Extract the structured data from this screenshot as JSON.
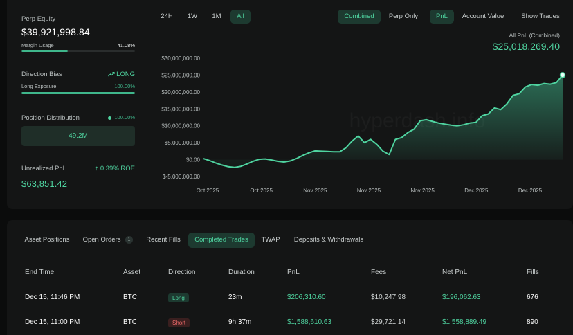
{
  "stats": {
    "perp_equity_label": "Perp Equity",
    "perp_equity_value": "$39,921,998.84",
    "margin_usage_label": "Margin Usage",
    "margin_usage_value": "41.08%",
    "margin_usage_fraction": 0.4108,
    "direction_bias_label": "Direction Bias",
    "direction_bias_value": "LONG",
    "long_exposure_label": "Long Exposure",
    "long_exposure_value": "100.00%",
    "long_exposure_fraction": 1.0,
    "position_distribution_label": "Position Distribution",
    "position_distribution_value": "100.00%",
    "position_distribution_amount": "49.2M",
    "unrealized_pnl_label": "Unrealized PnL",
    "unrealized_pnl_value": "$63,851.42",
    "roe_value": "0.39% ROE"
  },
  "range_buttons": [
    "24H",
    "1W",
    "1M",
    "All"
  ],
  "range_active": "All",
  "view_buttons": {
    "combined": "Combined",
    "perp_only": "Perp Only",
    "pnl": "PnL",
    "account_value": "Account Value",
    "show_trades": "Show Trades"
  },
  "chart_header": {
    "title": "All PnL (Combined)",
    "value": "$25,018,269.40"
  },
  "watermark": "hyperdash.info",
  "colors": {
    "accent": "#4fd4a0",
    "short": "#ef6b6b",
    "panel": "#141515"
  },
  "chart_data": {
    "type": "area",
    "title": "All PnL (Combined)",
    "ylabel": "",
    "xlabel": "",
    "ylim": [
      -5000000,
      30000000
    ],
    "yticks": [
      -5000000,
      0,
      5000000,
      10000000,
      15000000,
      20000000,
      25000000,
      30000000
    ],
    "ytick_labels": [
      "$-5,000,000.00",
      "$0.00",
      "$5,000,000.00",
      "$10,000,000.00",
      "$15,000,000.00",
      "$20,000,000.00",
      "$25,000,000.00",
      "$30,000,000.00"
    ],
    "xtick_labels": [
      "Oct 2025",
      "Oct 2025",
      "Nov 2025",
      "Nov 2025",
      "Nov 2025",
      "Dec 2025",
      "Dec 2025"
    ],
    "grid": false,
    "series": [
      {
        "values": [
          300000,
          -300000,
          -1000000,
          -1600000,
          -2100000,
          -2300000,
          -2000000,
          -1300000,
          -500000,
          100000,
          200000,
          -100000,
          -500000,
          -700000,
          -400000,
          300000,
          1200000,
          2000000,
          2600000,
          2500000,
          2400000,
          2300000,
          2300000,
          3500000,
          5500000,
          7000000,
          5000000,
          6000000,
          4500000,
          2500000,
          1500000,
          6000000,
          6500000,
          8000000,
          9000000,
          11500000,
          11800000,
          11300000,
          10800000,
          10500000,
          10200000,
          10000000,
          10300000,
          10800000,
          11000000,
          13000000,
          13500000,
          15300000,
          14800000,
          16500000,
          19000000,
          19500000,
          21500000,
          22200000,
          22000000,
          22500000,
          22300000,
          22800000,
          25018269.4
        ]
      }
    ]
  },
  "tabs": [
    {
      "label": "Asset Positions"
    },
    {
      "label": "Open Orders",
      "badge": "1"
    },
    {
      "label": "Recent Fills"
    },
    {
      "label": "Completed Trades"
    },
    {
      "label": "TWAP"
    },
    {
      "label": "Deposits & Withdrawals"
    }
  ],
  "table": {
    "headers": [
      "End Time",
      "Asset",
      "Direction",
      "Duration",
      "PnL",
      "Fees",
      "Net PnL",
      "Fills"
    ],
    "rows": [
      {
        "end_time": "Dec 15, 11:46 PM",
        "asset": "BTC",
        "direction": "Long",
        "duration": "23m",
        "pnl": "$206,310.60",
        "fees": "$10,247.98",
        "net_pnl": "$196,062.63",
        "fills": "676"
      },
      {
        "end_time": "Dec 15, 11:00 PM",
        "asset": "BTC",
        "direction": "Short",
        "duration": "9h 37m",
        "pnl": "$1,588,610.63",
        "fees": "$29,721.14",
        "net_pnl": "$1,558,889.49",
        "fills": "890"
      }
    ]
  }
}
